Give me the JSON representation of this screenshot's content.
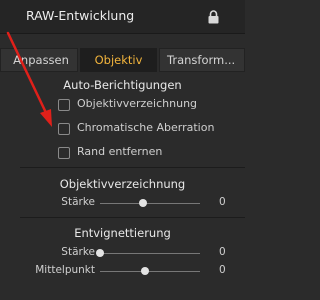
{
  "header": {
    "title": "RAW-Entwicklung",
    "lock_icon": "lock-icon"
  },
  "tabs": [
    {
      "label": "Anpassen",
      "active": false
    },
    {
      "label": "Objektiv",
      "active": true
    },
    {
      "label": "Transform...",
      "active": false
    }
  ],
  "auto_corrections": {
    "title": "Auto-Berichtigungen",
    "options": [
      {
        "label": "Objektivverzeichnung",
        "checked": false
      },
      {
        "label": "Chromatische Aberration",
        "checked": false
      },
      {
        "label": "Rand entfernen",
        "checked": false
      }
    ]
  },
  "distortion": {
    "title": "Objektivverzeichnung",
    "strength_label": "Stärke",
    "strength_value": "0"
  },
  "vignetting": {
    "title": "Entvignettierung",
    "strength_label": "Stärke",
    "strength_value": "0",
    "midpoint_label": "Mittelpunkt",
    "midpoint_value": "0"
  },
  "colors": {
    "accent_tab": "#f2b43c",
    "annotation_arrow": "#e0201a"
  }
}
